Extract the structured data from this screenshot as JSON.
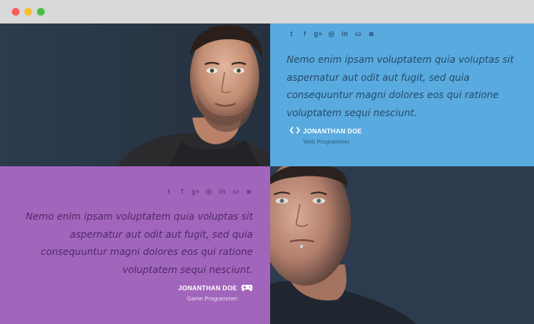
{
  "testimonials": [
    {
      "quote": "Nemo enim ipsam voluptatem quia voluptas sit aspernatur aut odit aut fugit, sed quia consequuntur magni dolores eos qui ratione voluptatem sequi nesciunt.",
      "name": "JONANTHAN DOE",
      "role": "Web Programmer",
      "role_icon": "code-icon",
      "accent": "#59aadf"
    },
    {
      "quote": "Nemo enim ipsam voluptatem quia voluptas sit aspernatur aut odit aut fugit, sed quia consequuntur magni dolores eos qui ratione voluptatem sequi nesciunt.",
      "name": "JONANTHAN DOE",
      "role": "Game Programmer",
      "role_icon": "gamepad-icon",
      "accent": "#a166bc"
    }
  ],
  "social_icons": {
    "twitter": "t",
    "facebook": "f",
    "google_plus": "g+",
    "dribbble": "◎",
    "linkedin": "in",
    "weibo": "ω",
    "instagram": "◙"
  },
  "colors": {
    "dark_panel": "#2c3b4d",
    "blue_panel": "#59aadf",
    "purple_panel": "#a166bc"
  }
}
